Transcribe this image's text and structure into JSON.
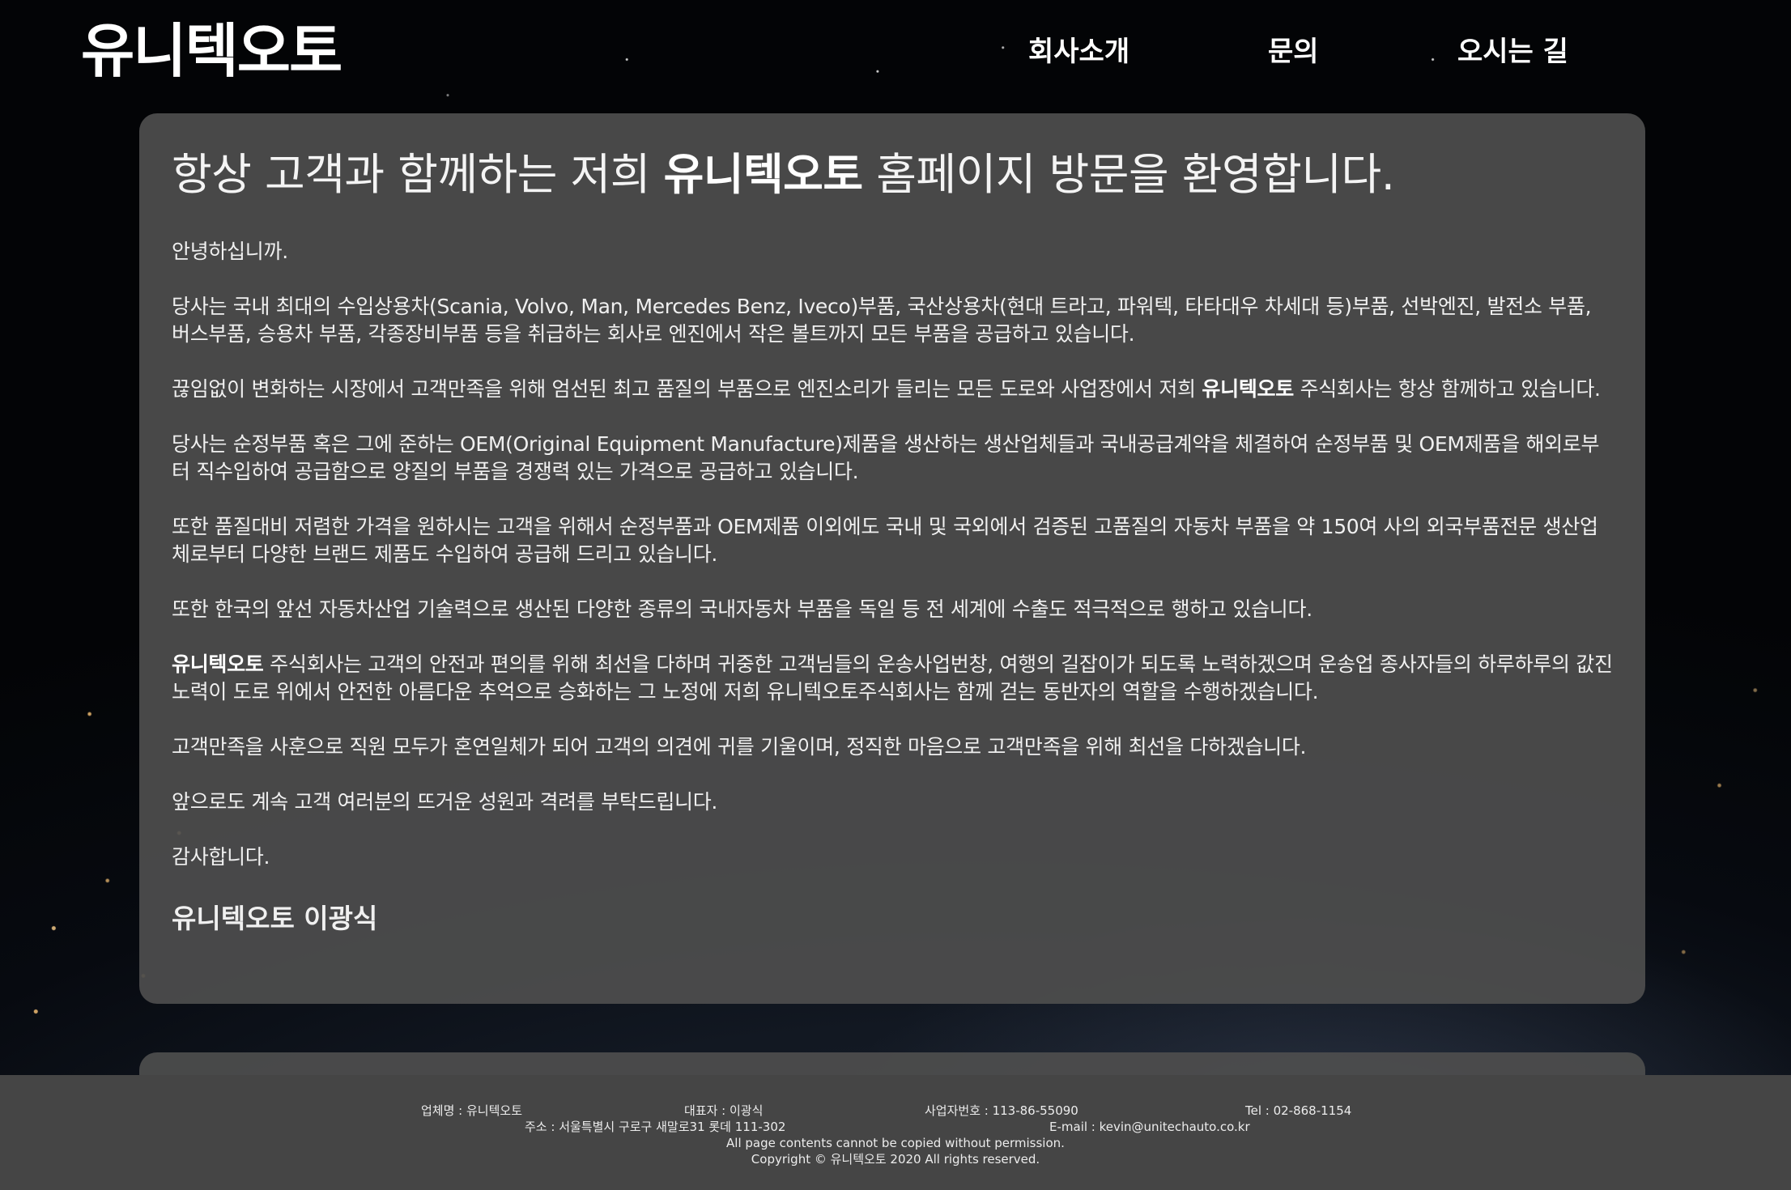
{
  "header": {
    "logo": "유니텍오토",
    "nav": [
      "회사소개",
      "문의",
      "오시는 길"
    ]
  },
  "main": {
    "title_prefix": "항상 고객과 함께하는 저희 ",
    "title_brand": "유니텍오토",
    "title_suffix": " 홈페이지 방문을 환영합니다.",
    "greeting": "안녕하십니까.",
    "p1": "당사는 국내 최대의 수입상용차(Scania, Volvo, Man, Mercedes Benz, Iveco)부품, 국산상용차(현대 트라고, 파워텍, 타타대우 차세대 등)부품, 선박엔진, 발전소 부품, 버스부품, 승용차 부품, 각종장비부품 등을 취급하는 회사로 엔진에서 작은 볼트까지 모든 부품을 공급하고 있습니다.",
    "p2_before": "끊임없이 변화하는 시장에서 고객만족을 위해 엄선된 최고 품질의 부품으로 엔진소리가 들리는 모든 도로와 사업장에서 저희 ",
    "p2_brand": "유니텍오토",
    "p2_after": " 주식회사는 항상 함께하고 있습니다.",
    "p3": "당사는 순정부품 혹은 그에 준하는 OEM(Original Equipment Manufacture)제품을 생산하는 생산업체들과 국내공급계약을 체결하여 순정부품 및 OEM제품을 해외로부터 직수입하여 공급함으로 양질의 부품을 경쟁력 있는 가격으로 공급하고 있습니다.",
    "p4": "또한 품질대비 저렴한 가격을 원하시는 고객을 위해서 순정부품과 OEM제품 이외에도 국내 및 국외에서 검증된 고품질의 자동차 부품을 약 150여 사의 외국부품전문 생산업체로부터 다양한 브랜드 제품도 수입하여 공급해 드리고 있습니다.",
    "p5": "또한 한국의 앞선 자동차산업 기술력으로 생산된 다양한 종류의 국내자동차 부품을 독일 등 전 세계에 수출도 적극적으로 행하고 있습니다.",
    "p6_brand": "유니텍오토",
    "p6_after": " 주식회사는 고객의 안전과 편의를 위해 최선을 다하며 귀중한 고객님들의 운송사업번창, 여행의 길잡이가 되도록 노력하겠으며 운송업 종사자들의 하루하루의 값진 노력이 도로 위에서 안전한 아름다운 추억으로 승화하는 그 노정에 저희 유니텍오토주식회사는 함께 걷는 동반자의 역할을 수행하겠습니다.",
    "p7": "고객만족을 사훈으로 직원 모두가 혼연일체가 되어 고객의 의견에 귀를 기울이며, 정직한 마음으로 고객만족을 위해 최선을 다하겠습니다.",
    "p8": "앞으로도 계속 고객 여러분의 뜨거운 성원과 격려를 부탁드립니다.",
    "p9": "감사합니다.",
    "signature": "유니텍오토 이광식"
  },
  "footer": {
    "company": "업체명 : 유니텍오토",
    "ceo": "대표자 : 이광식",
    "biz_no": "사업자번호 : 113-86-55090",
    "tel": "Tel : 02-868-1154",
    "address": "주소 : 서울특별시 구로구 새말로31 롯데 111-302",
    "email": "E-mail : kevin@unitechauto.co.kr",
    "notice": "All page contents cannot be copied without permission.",
    "copyright": "Copyright © 유니텍오토 2020 All rights reserved."
  },
  "colors": {
    "panel": "#4e4e4e",
    "footer": "#454545",
    "text": "#f0f0f0"
  }
}
